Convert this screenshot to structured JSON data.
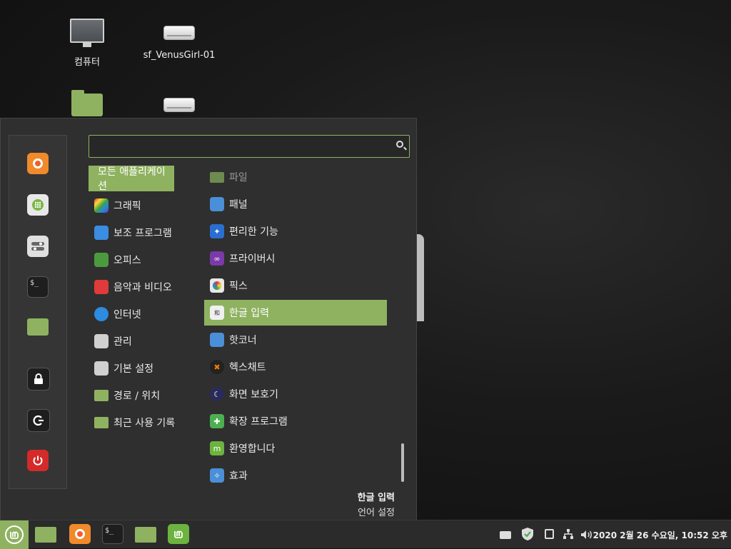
{
  "desktop": {
    "icons": [
      {
        "label": "컴퓨터",
        "icon": "computer-icon"
      },
      {
        "label": "sf_VenusGirl-01",
        "icon": "drive-icon"
      },
      {
        "label": "",
        "icon": "home-folder-icon"
      },
      {
        "label": "",
        "icon": "drive-icon"
      }
    ]
  },
  "menu": {
    "search": {
      "value": "",
      "placeholder": ""
    },
    "favorites": [
      "firefox-icon",
      "software-manager-icon",
      "settings-icon",
      "terminal-icon",
      "files-icon",
      "lock-icon",
      "logout-icon",
      "power-icon"
    ],
    "categories": [
      {
        "label": "모든 애플리케이션",
        "selected": true
      },
      {
        "label": "그래픽",
        "color": "#c04cdd"
      },
      {
        "label": "보조 프로그램",
        "color": "#3a8de0"
      },
      {
        "label": "오피스",
        "color": "#4c9a3e"
      },
      {
        "label": "음악과 비디오",
        "color": "#e03a3a"
      },
      {
        "label": "인터넷",
        "color": "#2d8be0"
      },
      {
        "label": "관리",
        "color": "#d0d0d0"
      },
      {
        "label": "기본 설정",
        "color": "#d0d0d0"
      },
      {
        "label": "경로 / 위치",
        "color": "#8fb261"
      },
      {
        "label": "최근 사용 기록",
        "color": "#8fb261"
      }
    ],
    "apps": [
      {
        "label": "파일",
        "color": "#6f8a4f",
        "dim": true
      },
      {
        "label": "패널",
        "color": "#4a8fd8"
      },
      {
        "label": "편리한 기능",
        "color": "#2a6fcf"
      },
      {
        "label": "프라이버시",
        "color": "#7a3aa8"
      },
      {
        "label": "픽스",
        "color": "#e8e8e8"
      },
      {
        "label": "한글 입력",
        "color": "#f0f0f0",
        "selected": true
      },
      {
        "label": "핫코너",
        "color": "#4a8fd8"
      },
      {
        "label": "헥스채트",
        "color": "#222222"
      },
      {
        "label": "화면 보호기",
        "color": "#2a2a5a"
      },
      {
        "label": "확장 프로그램",
        "color": "#4caf50"
      },
      {
        "label": "환영합니다",
        "color": "#6cb33f"
      },
      {
        "label": "효과",
        "color": "#4a8fd8"
      }
    ],
    "description": {
      "title": "한글 입력",
      "subtitle": "언어 설정"
    }
  },
  "panel": {
    "clock": "2020 2월 26 수요일, 10:52 오후",
    "accent": "#8fb261"
  }
}
